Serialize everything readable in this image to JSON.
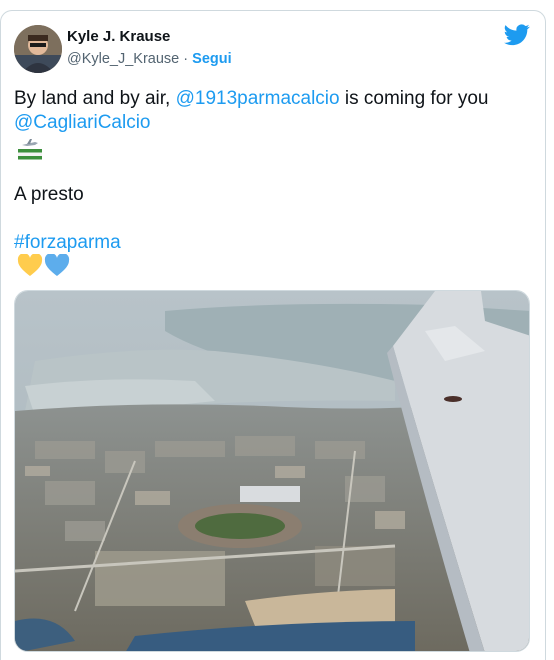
{
  "tweet": {
    "author_name": "Kyle J. Krause",
    "author_handle": "@Kyle_J_Krause",
    "separator": "·",
    "follow_label": "Segui",
    "text_line1_prefix": "By land and by air, ",
    "mention_1": "@1913parmacalcio",
    "text_line1_suffix": " is coming for you",
    "mention_2": "@CagliariCalcio",
    "line_2": "A presto",
    "hashtag": "#forzaparma"
  },
  "icons": {
    "brand": "twitter-bird-icon",
    "brand_color": "#1d9bf0",
    "emoji_1": "plane-and-flag-emoji",
    "emoji_2": "yellow-heart-emoji",
    "emoji_3": "blue-heart-emoji"
  },
  "colors": {
    "link": "#1d9bf0",
    "text": "#0f1419",
    "secondary": "#536471"
  }
}
